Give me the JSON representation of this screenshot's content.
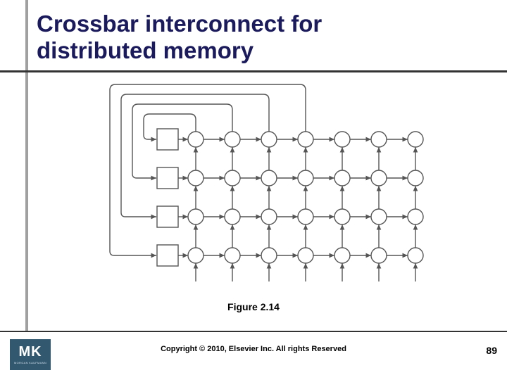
{
  "title_line1": "Crossbar interconnect for",
  "title_line2": "distributed memory",
  "figure_caption": "Figure 2.14",
  "copyright": "Copyright © 2010, Elsevier Inc. All rights Reserved",
  "page_number": "89",
  "logo_text": "MK",
  "logo_sub": "MORGAN KAUFMANN",
  "diagram": {
    "processors_count": 4,
    "columns_count": 7,
    "rows_count": 4,
    "description": "Crossbar interconnect: 4 processor squares on left feed into a 4x7 grid of circular switch nodes with bidirectional routing, top row connects back to processors via curved links."
  }
}
